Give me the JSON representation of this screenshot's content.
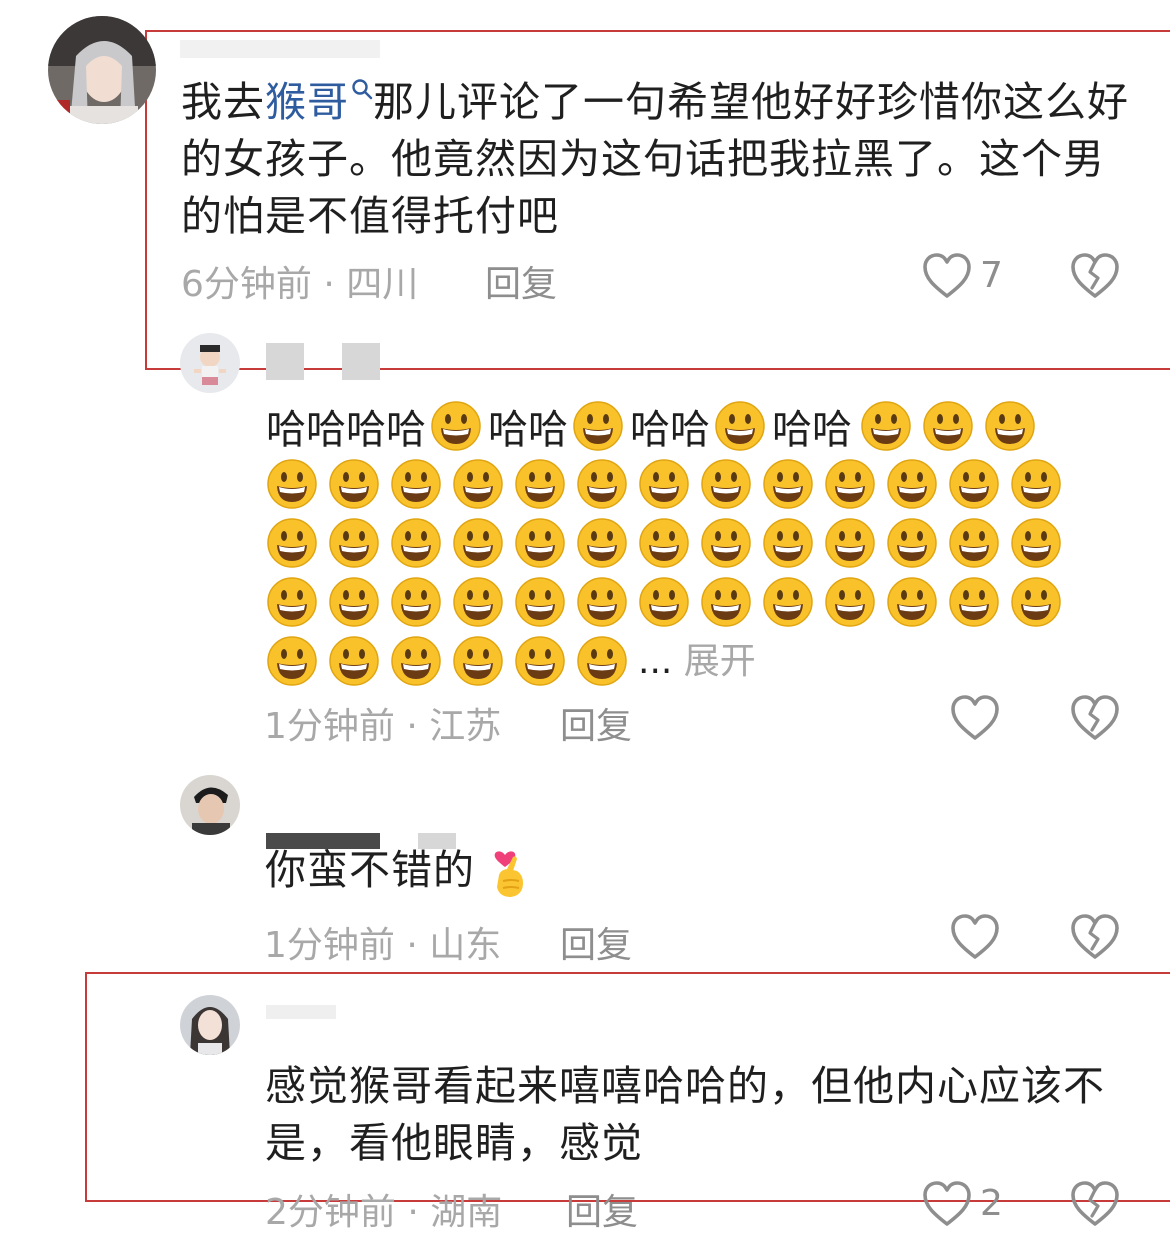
{
  "comments": [
    {
      "text_before_link": "我去",
      "link_text": "猴哥",
      "text_after_link": "那儿评论了一句希望他好好珍惜你这么好的女孩子。他竟然因为这句话把我拉黑了。这个男的怕是不值得托付吧",
      "meta": "6分钟前 · 四川",
      "reply_label": "回复",
      "likes": "7",
      "highlighted": true
    },
    {
      "text": "哈哈哈哈😃哈哈😃哈哈😃哈哈😃😃😃 + 😃×45",
      "text_prefix": [
        "哈哈哈哈",
        "哈哈",
        "哈哈",
        "哈哈"
      ],
      "emoji_count_line1_tail": 3,
      "emoji_rows_full": 3,
      "emoji_last_row": 6,
      "ellipsis": "...",
      "expand_label": "展开",
      "meta": "1分钟前 · 江苏",
      "reply_label": "回复",
      "likes": ""
    },
    {
      "text": "你蛮不错的",
      "emoji_name": "finger-heart",
      "meta": "1分钟前 · 山东",
      "reply_label": "回复",
      "likes": ""
    },
    {
      "text": "感觉猴哥看起来嘻嘻哈哈的，但他内心应该不是，看他眼睛，感觉",
      "meta": "2分钟前 · 湖南",
      "reply_label": "回复",
      "likes": "2",
      "highlighted": true
    }
  ],
  "icons": {
    "like": "heart-outline-icon",
    "dislike": "broken-heart-icon",
    "search": "search-icon",
    "emoji": "grinning-face-emoji"
  },
  "colors": {
    "link": "#2e5c9f",
    "meta": "#a8a8a8",
    "highlight_box": "#c73b3b",
    "emoji": "#f9c22a"
  }
}
